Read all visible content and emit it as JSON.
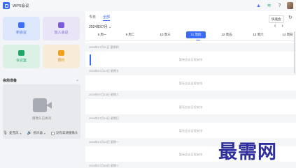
{
  "app": {
    "title": "WPS会议"
  },
  "titlebar": {
    "icons": [
      "upload-icon",
      "wifi-icon",
      "help-icon",
      "avatar"
    ]
  },
  "tiles": [
    {
      "label": "新会议",
      "icon": "video-icon",
      "color": "#3e6ff3"
    },
    {
      "label": "加入会议",
      "icon": "join-icon",
      "color": "#7a5cd9"
    },
    {
      "label": "会议室",
      "icon": "room-icon",
      "color": "#22a866"
    },
    {
      "label": "预约",
      "icon": "calendar-icon",
      "color": "#f0a01c"
    }
  ],
  "preview": {
    "title": "会前准备",
    "camera_text": "摄像头已关闭",
    "controls": {
      "mic": "麦克风",
      "speaker": "扬声器",
      "hd_label": "没有高清摄像头"
    }
  },
  "calendar": {
    "tabs": [
      "今日",
      "全部"
    ],
    "active_tab": "全部",
    "month": "2024年07月",
    "sync_button": "快速会",
    "days": [
      {
        "label": "8 周一"
      },
      {
        "label": "9 周二"
      },
      {
        "label": "10 周三"
      },
      {
        "label": "11 周四",
        "selected": true
      },
      {
        "label": "12 周五"
      },
      {
        "label": "13 周六"
      },
      {
        "label": "14 周日"
      }
    ],
    "entries": [
      {
        "date": "2024年07月11日 星期四",
        "empty_text": "暂无会议日程安排"
      },
      {
        "date": "2024年07月12日 星期五",
        "empty_text": "暂无会议日程安排"
      },
      {
        "date": "2024年07月13日 星期六",
        "empty_text": "暂无会议日程安排"
      },
      {
        "date": "2024年07月14日 星期日",
        "empty_text": "暂无会议日程安排"
      },
      {
        "date": "2024年07月15日 星期一",
        "empty_text": "暂无会议日程安排"
      },
      {
        "date": "2024年07月16日 星期二",
        "empty_text": ""
      }
    ],
    "accent": "#3b6cf4"
  },
  "watermark": "最需网"
}
